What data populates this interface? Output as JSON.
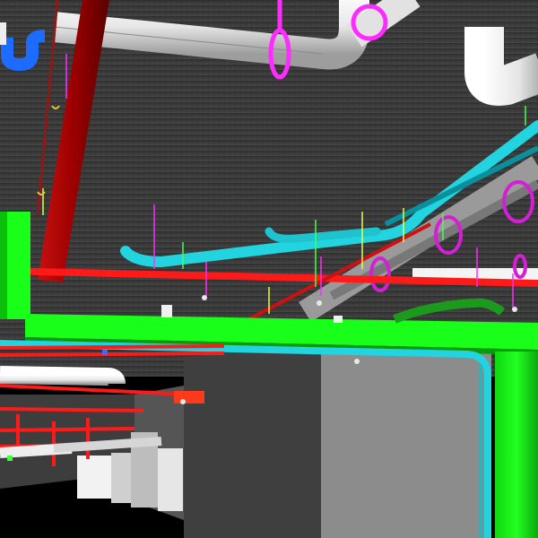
{
  "scene": {
    "kind": "3D MEP ceiling-service coordination model view (BIM)",
    "colors": {
      "ceiling": "#3a3a3a",
      "ceiling_dark": "#2a2a2a",
      "floor": "#000000",
      "concrete_wall": "#8a8a8a",
      "white_pipe": "#f2f2f2",
      "white_pipe_shade": "#b9b9b9",
      "red_fire_pipe": "#ff1a1a",
      "dark_red_pipe": "#8b0000",
      "cyan_pipe": "#22d3e0",
      "cyan_pipe_dark": "#0aa3b3",
      "green_duct": "#1aff1a",
      "green_duct_dark": "#0fbf0f",
      "magenta_hanger": "#ff2bff",
      "blue_trap": "#1e6bff",
      "yellow_marker": "#e6ff3a",
      "sprinkler_head": "#e8e8e8"
    },
    "systems": [
      {
        "name": "sanitary-drain",
        "color_ref": "white_pipe"
      },
      {
        "name": "fire-sprinkler-main",
        "color_ref": "red_fire_pipe"
      },
      {
        "name": "fire-riser",
        "color_ref": "dark_red_pipe"
      },
      {
        "name": "chilled-water",
        "color_ref": "cyan_pipe"
      },
      {
        "name": "supply-air-duct",
        "color_ref": "green_duct"
      },
      {
        "name": "pipe-hangers",
        "color_ref": "magenta_hanger"
      }
    ]
  }
}
